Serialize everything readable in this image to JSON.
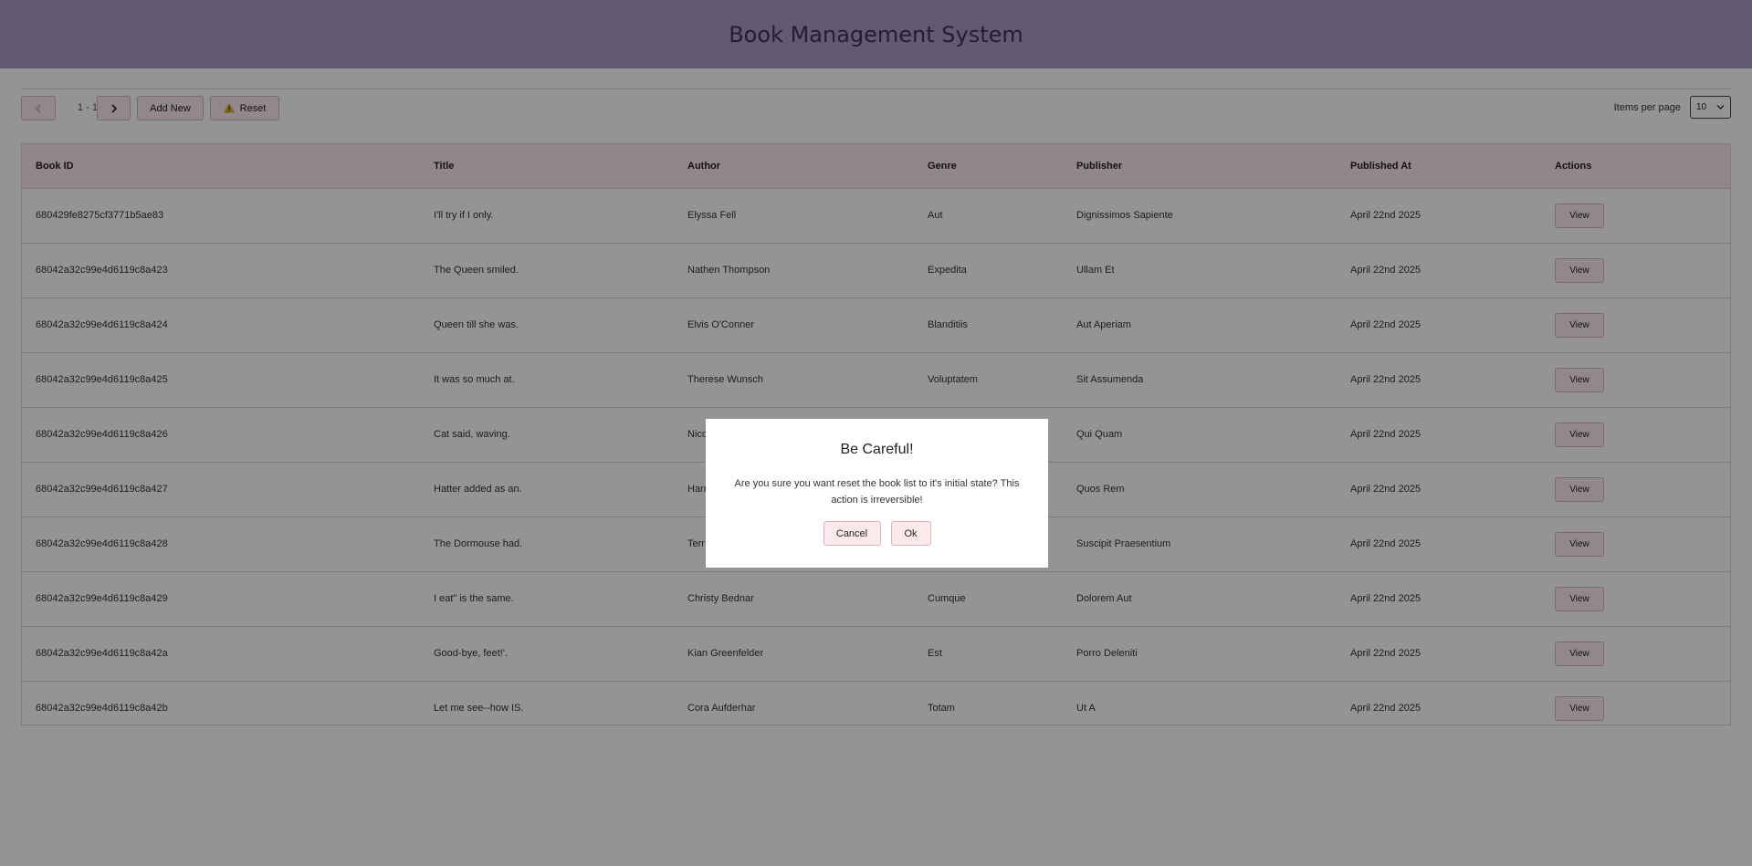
{
  "app": {
    "title": "Book Management System"
  },
  "toolbar": {
    "prev_icon": "chevron-left-icon",
    "page_range": "1 - 10",
    "next_icon": "chevron-right-icon",
    "add_new_label": "Add New",
    "reset_label": "Reset",
    "reset_icon": "warning-icon",
    "items_per_page_label": "Items per page",
    "items_per_page_value": "10"
  },
  "table": {
    "columns": [
      "Book ID",
      "Title",
      "Author",
      "Genre",
      "Publisher",
      "Published At",
      "Actions"
    ],
    "view_label": "View",
    "rows": [
      {
        "id": "680429fe8275cf3771b5ae83",
        "title": "I'll try if I only.",
        "author": "Elyssa Fell",
        "genre": "Aut",
        "publisher": "Dignissimos Sapiente",
        "published_at": "April 22nd 2025"
      },
      {
        "id": "68042a32c99e4d6119c8a423",
        "title": "The Queen smiled.",
        "author": "Nathen Thompson",
        "genre": "Expedita",
        "publisher": "Ullam Et",
        "published_at": "April 22nd 2025"
      },
      {
        "id": "68042a32c99e4d6119c8a424",
        "title": "Queen till she was.",
        "author": "Elvis O'Conner",
        "genre": "Blanditiis",
        "publisher": "Aut Aperiam",
        "published_at": "April 22nd 2025"
      },
      {
        "id": "68042a32c99e4d6119c8a425",
        "title": "It was so much at.",
        "author": "Therese Wunsch",
        "genre": "Voluptatem",
        "publisher": "Sit Assumenda",
        "published_at": "April 22nd 2025"
      },
      {
        "id": "68042a32c99e4d6119c8a426",
        "title": "Cat said, waving.",
        "author": "Nico",
        "genre": "",
        "publisher": "Qui Quam",
        "published_at": "April 22nd 2025"
      },
      {
        "id": "68042a32c99e4d6119c8a427",
        "title": "Hatter added as an.",
        "author": "Harr",
        "genre": "",
        "publisher": "Quos Rem",
        "published_at": "April 22nd 2025"
      },
      {
        "id": "68042a32c99e4d6119c8a428",
        "title": "The Dormouse had.",
        "author": "Terr",
        "genre": "",
        "publisher": "Suscipit Praesentium",
        "published_at": "April 22nd 2025"
      },
      {
        "id": "68042a32c99e4d6119c8a429",
        "title": "I eat\" is the same.",
        "author": "Christy Bednar",
        "genre": "Cumque",
        "publisher": "Dolorem Aut",
        "published_at": "April 22nd 2025"
      },
      {
        "id": "68042a32c99e4d6119c8a42a",
        "title": "Good-bye, feet!'.",
        "author": "Kian Greenfelder",
        "genre": "Est",
        "publisher": "Porro Deleniti",
        "published_at": "April 22nd 2025"
      },
      {
        "id": "68042a32c99e4d6119c8a42b",
        "title": "Let me see--how IS.",
        "author": "Cora Aufderhar",
        "genre": "Totam",
        "publisher": "Ut A",
        "published_at": "April 22nd 2025"
      }
    ]
  },
  "modal": {
    "title": "Be Careful!",
    "message": "Are you sure you want reset the book list to it's initial state? This action is irreversible!",
    "cancel_label": "Cancel",
    "ok_label": "Ok"
  },
  "colors": {
    "header_bg": "#a99ac6",
    "button_bg": "#fbe9ec",
    "button_border": "#d9b2ba",
    "table_header_bg": "#fbe7ea",
    "overlay": "rgba(0,0,0,0.42)"
  }
}
